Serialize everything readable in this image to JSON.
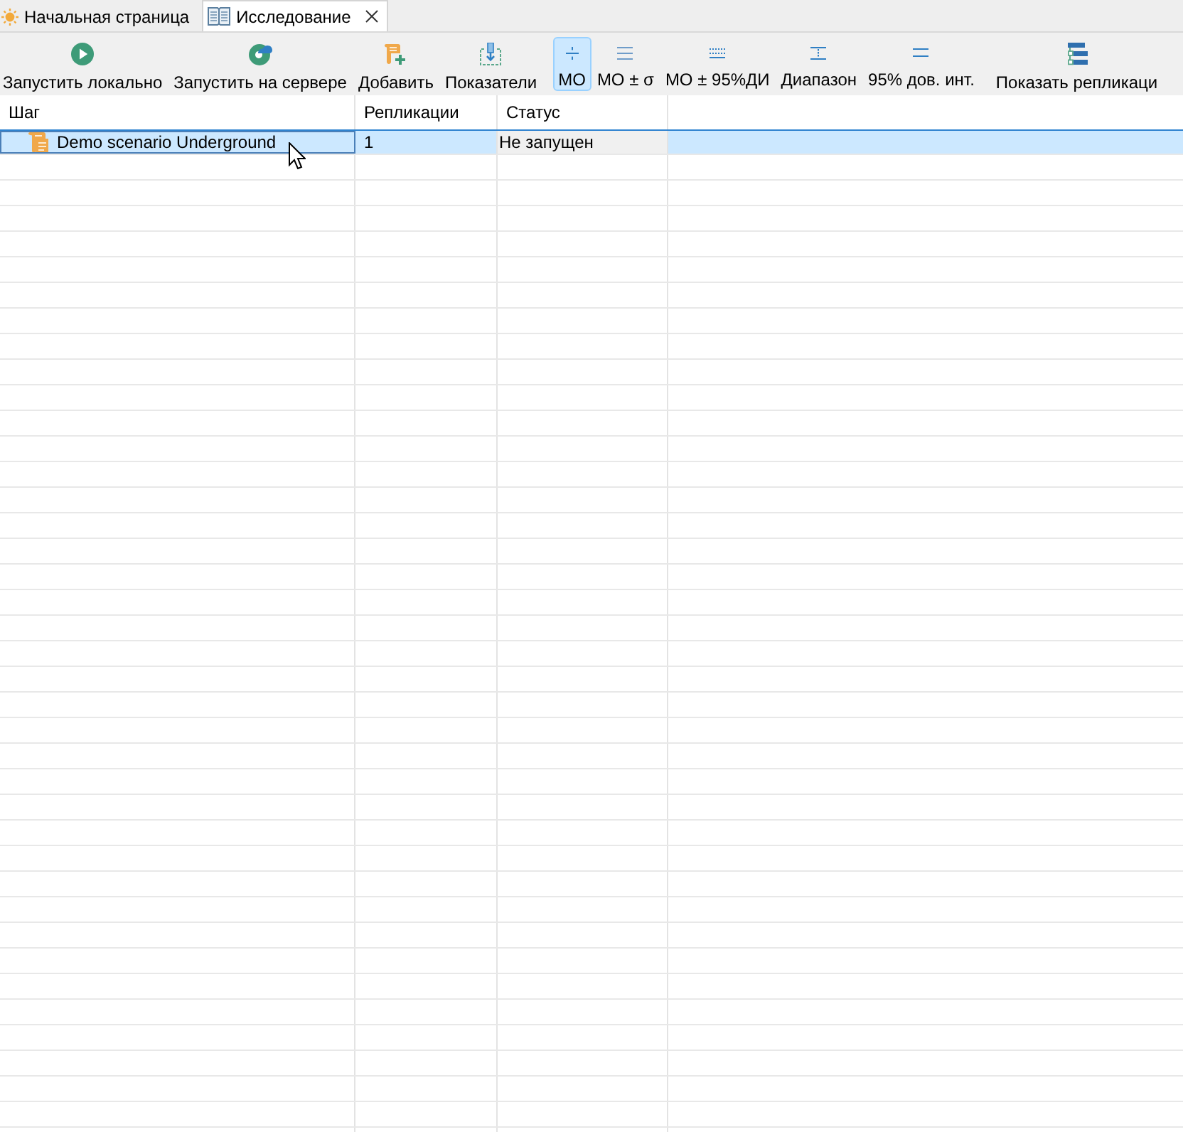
{
  "tabs": [
    {
      "label": "Начальная страница",
      "selected": false,
      "closable": false
    },
    {
      "label": "Исследование",
      "selected": true,
      "closable": true
    }
  ],
  "toolbar": {
    "buttons": [
      {
        "kind": "action",
        "label": "Запустить локально"
      },
      {
        "kind": "action",
        "label": "Запустить на сервере"
      },
      {
        "kind": "action",
        "label": "Добавить"
      },
      {
        "kind": "action",
        "label": "Показатели"
      },
      {
        "kind": "toggle",
        "label": "МО",
        "selected": true
      },
      {
        "kind": "toggle",
        "label": "МО ± σ",
        "selected": false
      },
      {
        "kind": "toggle",
        "label": "МО ± 95%ДИ",
        "selected": false
      },
      {
        "kind": "toggle",
        "label": "Диапазон",
        "selected": false
      },
      {
        "kind": "toggle",
        "label": "95% дов. инт.",
        "selected": false
      },
      {
        "kind": "action",
        "label": "Показать репликаци"
      }
    ]
  },
  "table": {
    "columns": [
      "Шаг",
      "Репликации",
      "Статус"
    ],
    "rows": [
      {
        "selected": true,
        "cells": [
          "Demo scenario Underground",
          "1",
          "Не запущен"
        ]
      }
    ]
  }
}
